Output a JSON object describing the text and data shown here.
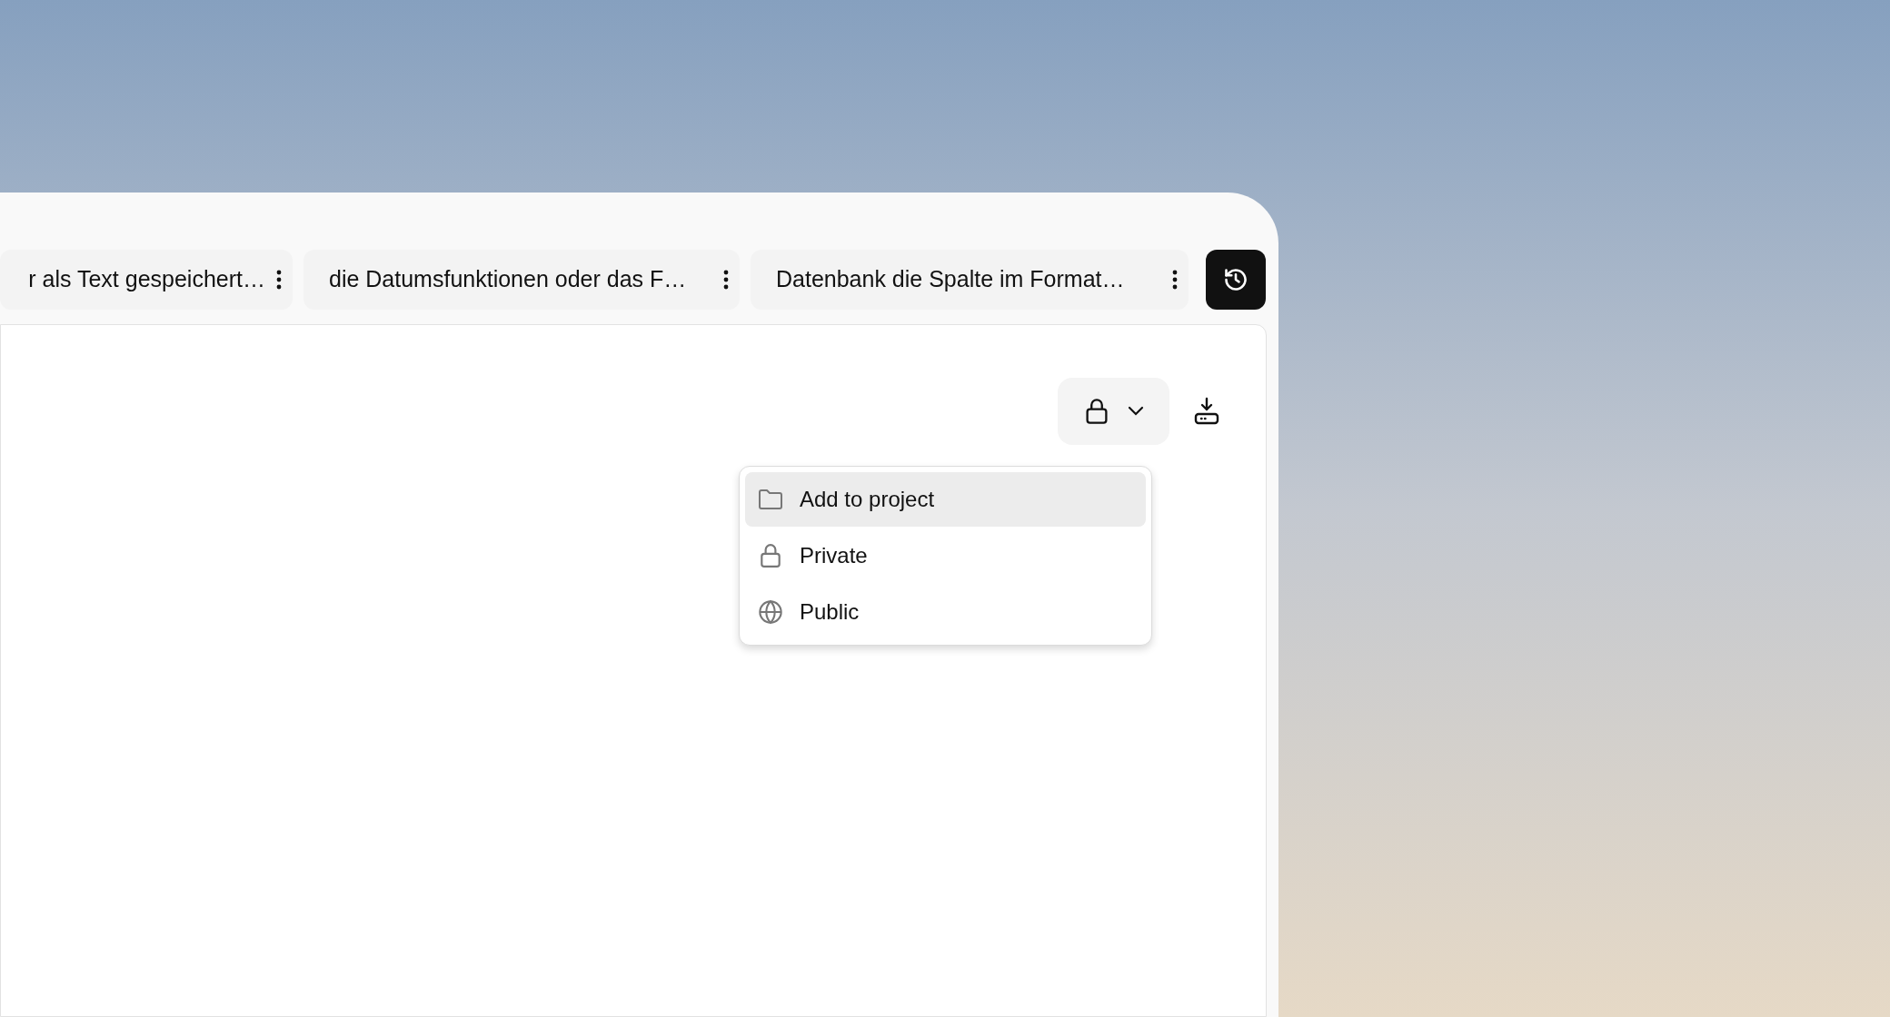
{
  "tabs": [
    {
      "label": "r als Text gespeichert…"
    },
    {
      "label": "die Datumsfunktionen oder das F…"
    },
    {
      "label": "Datenbank die Spalte im Format…"
    }
  ],
  "visibility_menu": {
    "items": [
      {
        "kind": "folder",
        "label": "Add to project",
        "selected": true
      },
      {
        "kind": "lock",
        "label": "Private",
        "selected": false
      },
      {
        "kind": "globe",
        "label": "Public",
        "selected": false
      }
    ]
  }
}
